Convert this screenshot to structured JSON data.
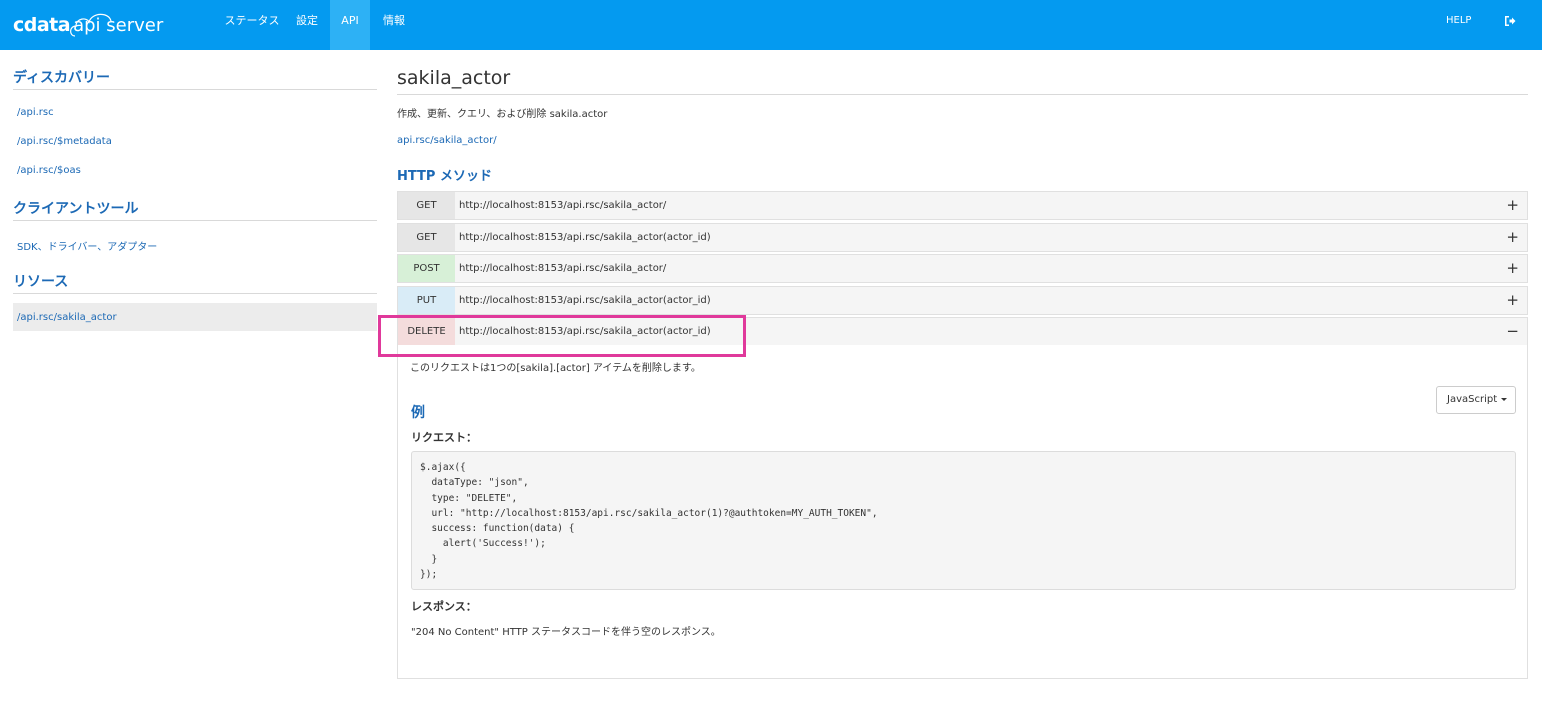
{
  "header": {
    "logo_brand": "cdata",
    "logo_product": "api server",
    "nav": [
      "ステータス",
      "設定",
      "API",
      "情報"
    ],
    "active_nav": "API",
    "help": "HELP",
    "logout_icon": "sign-out-icon"
  },
  "sidebar": {
    "discovery_title": "ディスカバリー",
    "discovery_links": [
      "/api.rsc",
      "/api.rsc/$metadata",
      "/api.rsc/$oas"
    ],
    "client_tools_title": "クライアントツール",
    "client_tools_links": [
      "SDK、ドライバー、アダプター"
    ],
    "resources_title": "リソース",
    "resources_links": [
      "/api.rsc/sakila_actor"
    ]
  },
  "main": {
    "title": "sakila_actor",
    "description": "作成、更新、クエリ、および削除 sakila.actor",
    "resource_url": "api.rsc/sakila_actor/",
    "methods_title": "HTTP メソッド",
    "methods": [
      {
        "verb": "GET",
        "url": "http://localhost:8153/api.rsc/sakila_actor/",
        "toggle": "+"
      },
      {
        "verb": "GET",
        "url": "http://localhost:8153/api.rsc/sakila_actor(actor_id)",
        "toggle": "+"
      },
      {
        "verb": "POST",
        "url": "http://localhost:8153/api.rsc/sakila_actor/",
        "toggle": "+"
      },
      {
        "verb": "PUT",
        "url": "http://localhost:8153/api.rsc/sakila_actor(actor_id)",
        "toggle": "+"
      },
      {
        "verb": "DELETE",
        "url": "http://localhost:8153/api.rsc/sakila_actor(actor_id)",
        "toggle": "−"
      }
    ],
    "delete_panel": {
      "description": "このリクエストは1つの[sakila].[actor] アイテムを削除します。",
      "language": "JavaScript",
      "example_title": "例",
      "request_title": "リクエスト：",
      "code": "$.ajax({\n  dataType: \"json\",\n  type: \"DELETE\",\n  url: \"http://localhost:8153/api.rsc/sakila_actor(1)?@authtoken=MY_AUTH_TOKEN\",\n  success: function(data) {\n    alert('Success!');\n  }\n});",
      "response_title": "レスポンス：",
      "response_text": "\"204 No Content\" HTTP ステータスコードを伴う空のレスポンス。"
    }
  },
  "colors": {
    "header_bg": "#049af0",
    "link": "#1c69b5",
    "highlight": "#e0399b"
  }
}
